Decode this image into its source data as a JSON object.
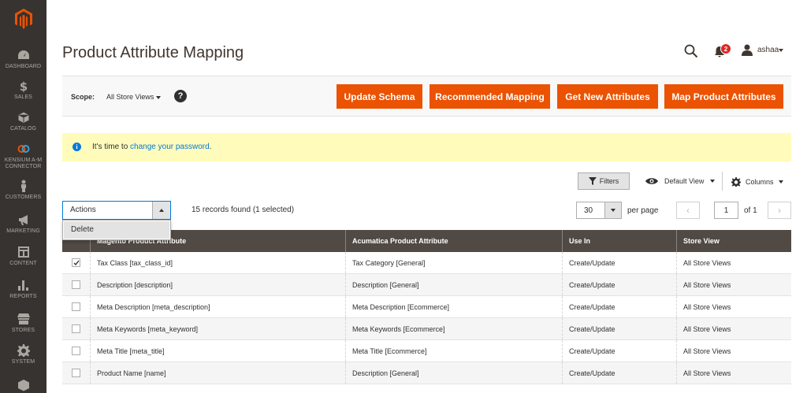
{
  "sidebar": {
    "items": [
      {
        "label": "DASHBOARD",
        "icon": "dashboard-icon"
      },
      {
        "label": "SALES",
        "icon": "dollar-icon"
      },
      {
        "label": "CATALOG",
        "icon": "box-icon"
      },
      {
        "label": "KENSIUM A-M\nCONNECTOR",
        "icon": "connector-icon"
      },
      {
        "label": "CUSTOMERS",
        "icon": "person-icon"
      },
      {
        "label": "MARKETING",
        "icon": "megaphone-icon"
      },
      {
        "label": "CONTENT",
        "icon": "layout-icon"
      },
      {
        "label": "REPORTS",
        "icon": "bar-chart-icon"
      },
      {
        "label": "STORES",
        "icon": "store-icon"
      },
      {
        "label": "SYSTEM",
        "icon": "gear-icon"
      }
    ]
  },
  "header": {
    "title": "Product Attribute Mapping",
    "notification_count": "2",
    "user": "ashaa"
  },
  "scope": {
    "label": "Scope:",
    "value": "All Store Views",
    "help": "?"
  },
  "buttons": {
    "update_schema": "Update Schema",
    "recommended_mapping": "Recommended Mapping",
    "get_new_attributes": "Get New Attributes",
    "map_product_attributes": "Map Product Attributes"
  },
  "message": {
    "icon": "i",
    "prefix": "It's time to ",
    "link": "change your password",
    "suffix": "."
  },
  "grid": {
    "filters_label": "Filters",
    "view_label": "Default View",
    "columns_label": "Columns",
    "actions_label": "Actions",
    "actions_menu": [
      "Delete"
    ],
    "records": "15 records found (1 selected)",
    "per_page_value": "30",
    "per_page_label": "per page",
    "page_value": "1",
    "page_of": "of 1",
    "columns": [
      "Magento Product Attribute",
      "Acumatica Product Attribute",
      "Use In",
      "Store View"
    ],
    "rows": [
      {
        "checked": true,
        "magento": "Tax Class [tax_class_id]",
        "acumatica": "Tax Category [General]",
        "use_in": "Create/Update",
        "store": "All Store Views"
      },
      {
        "checked": false,
        "magento": "Description [description]",
        "acumatica": "Description [General]",
        "use_in": "Create/Update",
        "store": "All Store Views"
      },
      {
        "checked": false,
        "magento": "Meta Description [meta_description]",
        "acumatica": "Meta Description [Ecommerce]",
        "use_in": "Create/Update",
        "store": "All Store Views"
      },
      {
        "checked": false,
        "magento": "Meta Keywords [meta_keyword]",
        "acumatica": "Meta Keywords [Ecommerce]",
        "use_in": "Create/Update",
        "store": "All Store Views"
      },
      {
        "checked": false,
        "magento": "Meta Title [meta_title]",
        "acumatica": "Meta Title [Ecommerce]",
        "use_in": "Create/Update",
        "store": "All Store Views"
      },
      {
        "checked": false,
        "magento": "Product Name [name]",
        "acumatica": "Description [General]",
        "use_in": "Create/Update",
        "store": "All Store Views"
      }
    ]
  },
  "colors": {
    "sidebar": "#373330",
    "accent": "#eb5202",
    "table_header": "#514943",
    "message_bg": "#fffbbb",
    "link": "#007bdb"
  }
}
